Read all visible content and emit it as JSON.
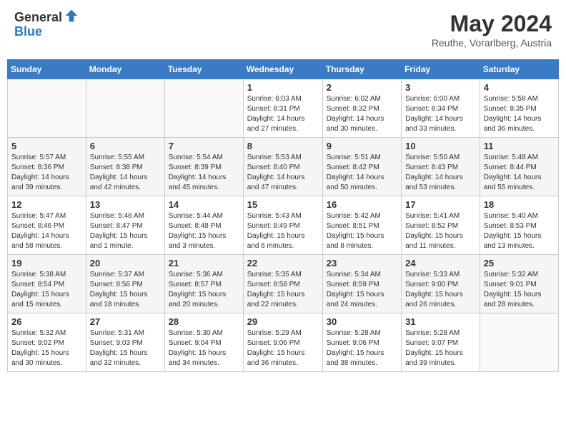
{
  "header": {
    "logo_general": "General",
    "logo_blue": "Blue",
    "month_title": "May 2024",
    "location": "Reuthe, Vorarlberg, Austria"
  },
  "weekdays": [
    "Sunday",
    "Monday",
    "Tuesday",
    "Wednesday",
    "Thursday",
    "Friday",
    "Saturday"
  ],
  "weeks": [
    [
      {
        "day": "",
        "info": ""
      },
      {
        "day": "",
        "info": ""
      },
      {
        "day": "",
        "info": ""
      },
      {
        "day": "1",
        "info": "Sunrise: 6:03 AM\nSunset: 8:31 PM\nDaylight: 14 hours\nand 27 minutes."
      },
      {
        "day": "2",
        "info": "Sunrise: 6:02 AM\nSunset: 8:32 PM\nDaylight: 14 hours\nand 30 minutes."
      },
      {
        "day": "3",
        "info": "Sunrise: 6:00 AM\nSunset: 8:34 PM\nDaylight: 14 hours\nand 33 minutes."
      },
      {
        "day": "4",
        "info": "Sunrise: 5:58 AM\nSunset: 8:35 PM\nDaylight: 14 hours\nand 36 minutes."
      }
    ],
    [
      {
        "day": "5",
        "info": "Sunrise: 5:57 AM\nSunset: 8:36 PM\nDaylight: 14 hours\nand 39 minutes."
      },
      {
        "day": "6",
        "info": "Sunrise: 5:55 AM\nSunset: 8:38 PM\nDaylight: 14 hours\nand 42 minutes."
      },
      {
        "day": "7",
        "info": "Sunrise: 5:54 AM\nSunset: 8:39 PM\nDaylight: 14 hours\nand 45 minutes."
      },
      {
        "day": "8",
        "info": "Sunrise: 5:53 AM\nSunset: 8:40 PM\nDaylight: 14 hours\nand 47 minutes."
      },
      {
        "day": "9",
        "info": "Sunrise: 5:51 AM\nSunset: 8:42 PM\nDaylight: 14 hours\nand 50 minutes."
      },
      {
        "day": "10",
        "info": "Sunrise: 5:50 AM\nSunset: 8:43 PM\nDaylight: 14 hours\nand 53 minutes."
      },
      {
        "day": "11",
        "info": "Sunrise: 5:48 AM\nSunset: 8:44 PM\nDaylight: 14 hours\nand 55 minutes."
      }
    ],
    [
      {
        "day": "12",
        "info": "Sunrise: 5:47 AM\nSunset: 8:46 PM\nDaylight: 14 hours\nand 58 minutes."
      },
      {
        "day": "13",
        "info": "Sunrise: 5:46 AM\nSunset: 8:47 PM\nDaylight: 15 hours\nand 1 minute."
      },
      {
        "day": "14",
        "info": "Sunrise: 5:44 AM\nSunset: 8:48 PM\nDaylight: 15 hours\nand 3 minutes."
      },
      {
        "day": "15",
        "info": "Sunrise: 5:43 AM\nSunset: 8:49 PM\nDaylight: 15 hours\nand 6 minutes."
      },
      {
        "day": "16",
        "info": "Sunrise: 5:42 AM\nSunset: 8:51 PM\nDaylight: 15 hours\nand 8 minutes."
      },
      {
        "day": "17",
        "info": "Sunrise: 5:41 AM\nSunset: 8:52 PM\nDaylight: 15 hours\nand 11 minutes."
      },
      {
        "day": "18",
        "info": "Sunrise: 5:40 AM\nSunset: 8:53 PM\nDaylight: 15 hours\nand 13 minutes."
      }
    ],
    [
      {
        "day": "19",
        "info": "Sunrise: 5:38 AM\nSunset: 8:54 PM\nDaylight: 15 hours\nand 15 minutes."
      },
      {
        "day": "20",
        "info": "Sunrise: 5:37 AM\nSunset: 8:56 PM\nDaylight: 15 hours\nand 18 minutes."
      },
      {
        "day": "21",
        "info": "Sunrise: 5:36 AM\nSunset: 8:57 PM\nDaylight: 15 hours\nand 20 minutes."
      },
      {
        "day": "22",
        "info": "Sunrise: 5:35 AM\nSunset: 8:58 PM\nDaylight: 15 hours\nand 22 minutes."
      },
      {
        "day": "23",
        "info": "Sunrise: 5:34 AM\nSunset: 8:59 PM\nDaylight: 15 hours\nand 24 minutes."
      },
      {
        "day": "24",
        "info": "Sunrise: 5:33 AM\nSunset: 9:00 PM\nDaylight: 15 hours\nand 26 minutes."
      },
      {
        "day": "25",
        "info": "Sunrise: 5:32 AM\nSunset: 9:01 PM\nDaylight: 15 hours\nand 28 minutes."
      }
    ],
    [
      {
        "day": "26",
        "info": "Sunrise: 5:32 AM\nSunset: 9:02 PM\nDaylight: 15 hours\nand 30 minutes."
      },
      {
        "day": "27",
        "info": "Sunrise: 5:31 AM\nSunset: 9:03 PM\nDaylight: 15 hours\nand 32 minutes."
      },
      {
        "day": "28",
        "info": "Sunrise: 5:30 AM\nSunset: 9:04 PM\nDaylight: 15 hours\nand 34 minutes."
      },
      {
        "day": "29",
        "info": "Sunrise: 5:29 AM\nSunset: 9:06 PM\nDaylight: 15 hours\nand 36 minutes."
      },
      {
        "day": "30",
        "info": "Sunrise: 5:28 AM\nSunset: 9:06 PM\nDaylight: 15 hours\nand 38 minutes."
      },
      {
        "day": "31",
        "info": "Sunrise: 5:28 AM\nSunset: 9:07 PM\nDaylight: 15 hours\nand 39 minutes."
      },
      {
        "day": "",
        "info": ""
      }
    ]
  ]
}
